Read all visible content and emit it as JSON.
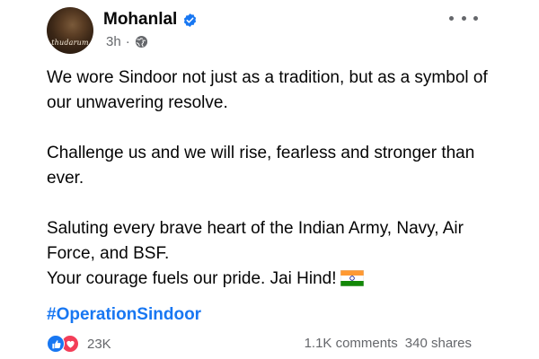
{
  "post": {
    "author": "Mohanlal",
    "avatar_caption": "thudarum",
    "time": "3h",
    "separator": "·",
    "paragraphs": [
      "We wore Sindoor not just as a tradition, but as a symbol of our unwavering resolve.",
      "Challenge us and we will rise, fearless and stronger than ever."
    ],
    "line3": "Saluting every brave heart of the Indian Army, Navy, Air Force, and BSF.",
    "line4": "Your courage fuels our pride. Jai Hind!",
    "hashtag": "#OperationSindoor",
    "reaction_count": "23K",
    "comments": "1.1K comments",
    "shares": "340 shares"
  },
  "icons": {
    "verified": "verified-badge-icon",
    "audience": "globe-icon",
    "flag": "india-flag-icon",
    "like": "like-reaction-icon",
    "love": "love-reaction-icon",
    "more": "more-options-icon"
  },
  "colors": {
    "link": "#1877f2",
    "secondary_text": "#65676b",
    "like": "#1877f2",
    "love": "#f33e58"
  }
}
